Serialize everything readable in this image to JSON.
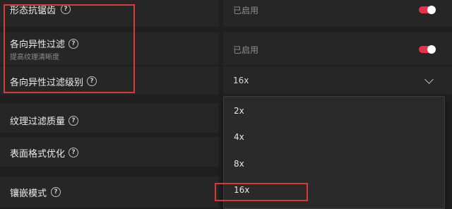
{
  "settings": {
    "morph_aa": {
      "label": "形态抗锯齿",
      "value": "已启用"
    },
    "aniso": {
      "label": "各向异性过滤",
      "description": "提高纹理清晰度",
      "value": "已启用"
    },
    "aniso_level": {
      "label": "各向异性过滤级别",
      "value": "16x"
    },
    "texture_quality": {
      "label": "纹理过滤质量"
    },
    "surface_format": {
      "label": "表面格式优化"
    },
    "tessellation": {
      "label": "镶嵌模式"
    }
  },
  "dropdown": {
    "options": [
      "2x",
      "4x",
      "8x",
      "16x"
    ],
    "selected": "16x"
  },
  "colors": {
    "accent": "#e8324a",
    "annotation": "#d83a3a"
  }
}
